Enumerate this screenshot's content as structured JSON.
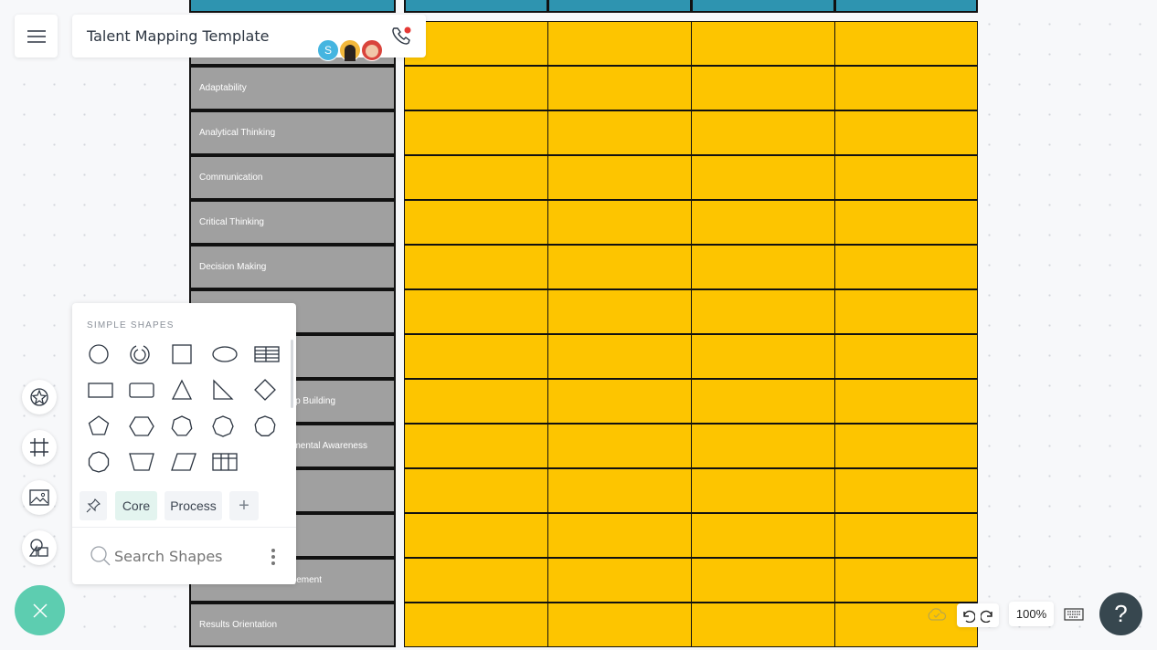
{
  "header": {
    "title": "Talent Mapping Template",
    "avatar_initial": "S",
    "menu_icon": "hamburger-icon",
    "call_icon": "phone-icon"
  },
  "table": {
    "rows": [
      "",
      "Adaptability",
      "Analytical Thinking",
      "Communication",
      "Critical Thinking",
      "Decision Making",
      "",
      "",
      "",
      "",
      "",
      "",
      "",
      "Results Orientation"
    ],
    "partial_rows": [
      {
        "row": 8,
        "text": "p Building"
      },
      {
        "row": 9,
        "text": "mental Awareness"
      },
      {
        "row": 12,
        "text": "gement"
      }
    ],
    "header_color": "#2e94b0",
    "cell_color": "#fdc500",
    "label_color": "#a0a0a0"
  },
  "left_tools": [
    "star-shape-icon",
    "frame-icon",
    "image-icon",
    "shapes-icon"
  ],
  "shapes_panel": {
    "section": "SIMPLE SHAPES",
    "shapes": [
      "circle",
      "donut",
      "square",
      "ellipse",
      "table-lines",
      "rectangle",
      "rounded-rectangle",
      "triangle",
      "right-triangle",
      "diamond",
      "pentagon",
      "hexagon",
      "heptagon",
      "octagon",
      "nonagon",
      "decagon",
      "trapezoid",
      "parallelogram",
      "table-grid"
    ],
    "tabs": {
      "core": "Core",
      "process": "Process"
    },
    "search_placeholder": "Search Shapes"
  },
  "bottom": {
    "zoom": "100%"
  },
  "colors": {
    "fab": "#5dcdb0",
    "help": "#37474f",
    "accent_tab": "#e3f4ef"
  }
}
